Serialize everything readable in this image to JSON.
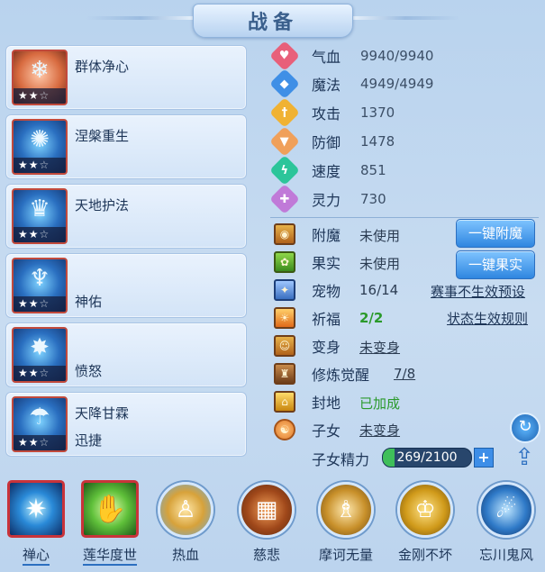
{
  "title": "战备",
  "skills": [
    {
      "name": "群体净心",
      "sub": "",
      "stars_on": 2,
      "stars_total": 3,
      "icon": "ice-pop-icon"
    },
    {
      "name": "涅槃重生",
      "sub": "",
      "stars_on": 2,
      "stars_total": 3,
      "icon": "phoenix-icon"
    },
    {
      "name": "天地护法",
      "sub": "",
      "stars_on": 2,
      "stars_total": 3,
      "icon": "guardian-icon"
    },
    {
      "name": "",
      "sub": "神佑",
      "stars_on": 2,
      "stars_total": 3,
      "icon": "blessing-icon"
    },
    {
      "name": "",
      "sub": "愤怒",
      "stars_on": 2,
      "stars_total": 3,
      "icon": "rage-icon"
    },
    {
      "name": "天降甘霖",
      "sub": "迅捷",
      "stars_on": 2,
      "stars_total": 3,
      "icon": "rain-icon"
    }
  ],
  "stats": [
    {
      "label": "气血",
      "value": "9940/9940",
      "icon": "heart-icon",
      "color": "#e8607a"
    },
    {
      "label": "魔法",
      "value": "4949/4949",
      "icon": "mana-icon",
      "color": "#3f8fe6"
    },
    {
      "label": "攻击",
      "value": "1370",
      "icon": "sword-icon",
      "color": "#f0b233"
    },
    {
      "label": "防御",
      "value": "1478",
      "icon": "shield-icon",
      "color": "#f0a05a"
    },
    {
      "label": "速度",
      "value": "851",
      "icon": "speed-icon",
      "color": "#2cc59a"
    },
    {
      "label": "灵力",
      "value": "730",
      "icon": "spirit-icon",
      "color": "#c07ad8"
    }
  ],
  "states": {
    "enchant": {
      "label": "附魔",
      "value": "未使用",
      "button": "一键附魔"
    },
    "fruit": {
      "label": "果实",
      "value": "未使用",
      "button": "一键果实"
    },
    "pet": {
      "label": "宠物",
      "value": "16/14",
      "link": "赛事不生效预设"
    },
    "bless": {
      "label": "祈福",
      "value": "2/2",
      "link": "状态生效规则"
    },
    "transform": {
      "label": "变身",
      "value": "未变身"
    },
    "cultivate": {
      "label": "修炼觉醒",
      "value": "7/8"
    },
    "fief": {
      "label": "封地",
      "value": "已加成"
    },
    "child": {
      "label": "子女",
      "value": "未变身"
    },
    "child_energy": {
      "label": "子女精力",
      "value": "269/2100",
      "fraction": 0.128
    }
  },
  "bottom_skills": [
    {
      "label": "禅心",
      "icon": "zen-orb-icon",
      "style": "square"
    },
    {
      "label": "莲华度世",
      "icon": "lotus-hand-icon",
      "style": "square"
    },
    {
      "label": "热血",
      "icon": "hot-blood-icon",
      "style": "round"
    },
    {
      "label": "慈悲",
      "icon": "mercy-icon",
      "style": "round"
    },
    {
      "label": "摩诃无量",
      "icon": "mahe-icon",
      "style": "round"
    },
    {
      "label": "金刚不坏",
      "icon": "vajra-icon",
      "style": "round"
    },
    {
      "label": "忘川鬼风",
      "icon": "ghost-wind-icon",
      "style": "round"
    }
  ]
}
